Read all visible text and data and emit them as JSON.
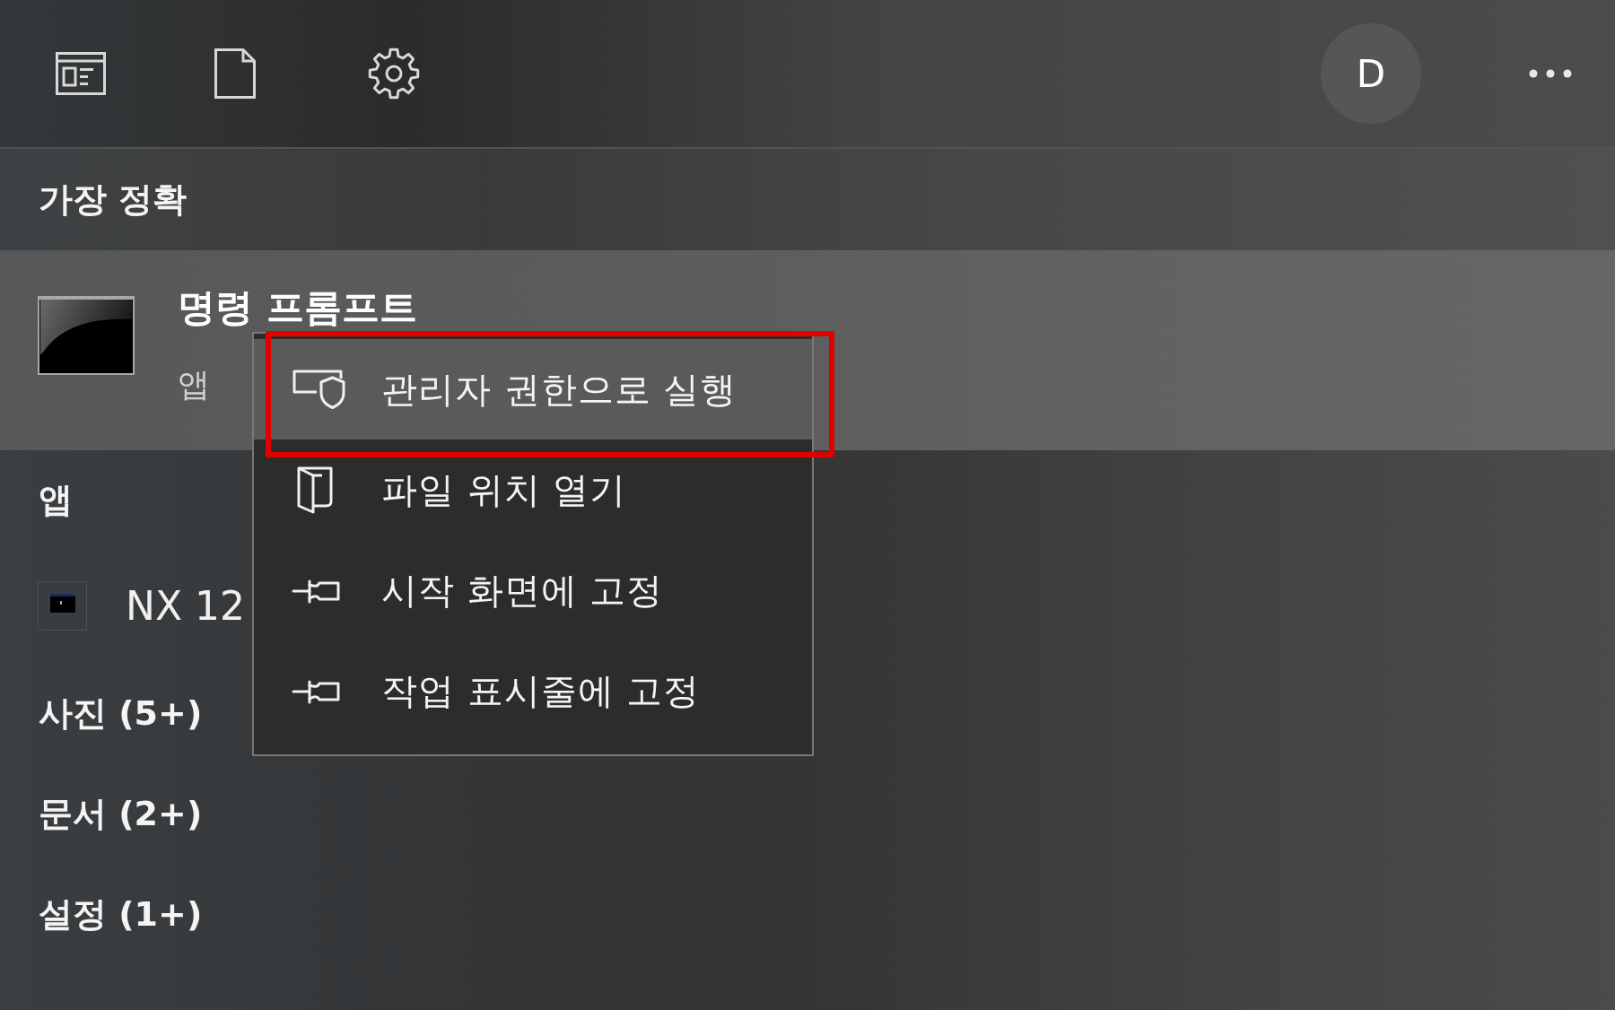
{
  "account": {
    "initial": "D"
  },
  "best_match": {
    "heading": "가장 정확",
    "title": "명령 프롬프트",
    "subtitle": "앱",
    "selected": true
  },
  "apps": {
    "heading": "앱",
    "items": [
      {
        "label": "NX 12"
      }
    ]
  },
  "categories": [
    {
      "label": "사진 (5+)"
    },
    {
      "label": "문서 (2+)"
    },
    {
      "label": "설정 (1+)"
    }
  ],
  "context_menu": {
    "items": [
      {
        "kind": "shield",
        "label": "관리자 권한으로 실행",
        "selected": true,
        "outlined": true
      },
      {
        "kind": "folder",
        "label": "파일 위치 열기",
        "selected": false,
        "outlined": false
      },
      {
        "kind": "pin",
        "label": "시작 화면에 고정",
        "selected": false,
        "outlined": false
      },
      {
        "kind": "pin",
        "label": "작업 표시줄에 고정",
        "selected": false,
        "outlined": false
      }
    ]
  }
}
